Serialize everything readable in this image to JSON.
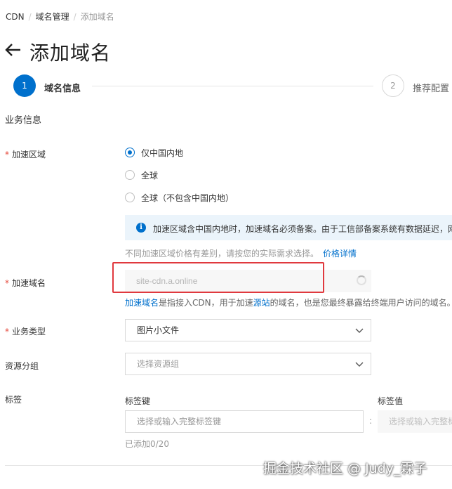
{
  "breadcrumb": {
    "items": [
      "CDN",
      "域名管理",
      "添加域名"
    ],
    "separator": "/"
  },
  "header": {
    "back_icon": "arrow-left-icon",
    "title": "添加域名"
  },
  "steps": [
    {
      "number": "1",
      "label": "域名信息",
      "active": true
    },
    {
      "number": "2",
      "label": "推荐配置",
      "active": false
    }
  ],
  "section_title": "业务信息",
  "form": {
    "region": {
      "label": "加速区域",
      "required": true,
      "options": [
        "仅中国内地",
        "全球",
        "全球（不包含中国内地）"
      ],
      "selected": "仅中国内地",
      "info": "加速区域含中国内地时，加速域名必须备案。由于工信部备案系统有数据延迟，网",
      "price_note": "不同加速区域价格有差别，请按您的实际需求选择。",
      "price_link": "价格详情"
    },
    "domain": {
      "label": "加速域名",
      "required": true,
      "value": "site-cdn.a.online",
      "help_prefix_link": "加速域名",
      "help_mid1": "是指接入CDN，用于加速",
      "help_link2": "源站",
      "help_rest": "的域名，也是您最终暴露给终端用户访问的域名。"
    },
    "business_type": {
      "label": "业务类型",
      "required": true,
      "value": "图片小文件"
    },
    "resource_group": {
      "label": "资源分组",
      "placeholder": "选择资源组"
    },
    "tags": {
      "label": "标签",
      "key_label": "标签键",
      "value_label": "标签值",
      "key_placeholder": "选择或输入完整标签键",
      "value_placeholder": "选择或输入完整标签值",
      "separator": ":",
      "count": "已添加0/20"
    }
  },
  "watermark": "掘金技术社区 @ Judy_霖子",
  "colors": {
    "primary": "#0070cc",
    "required": "#e5483b",
    "highlight": "#e0393e",
    "info_bg": "#ebf4fb"
  }
}
